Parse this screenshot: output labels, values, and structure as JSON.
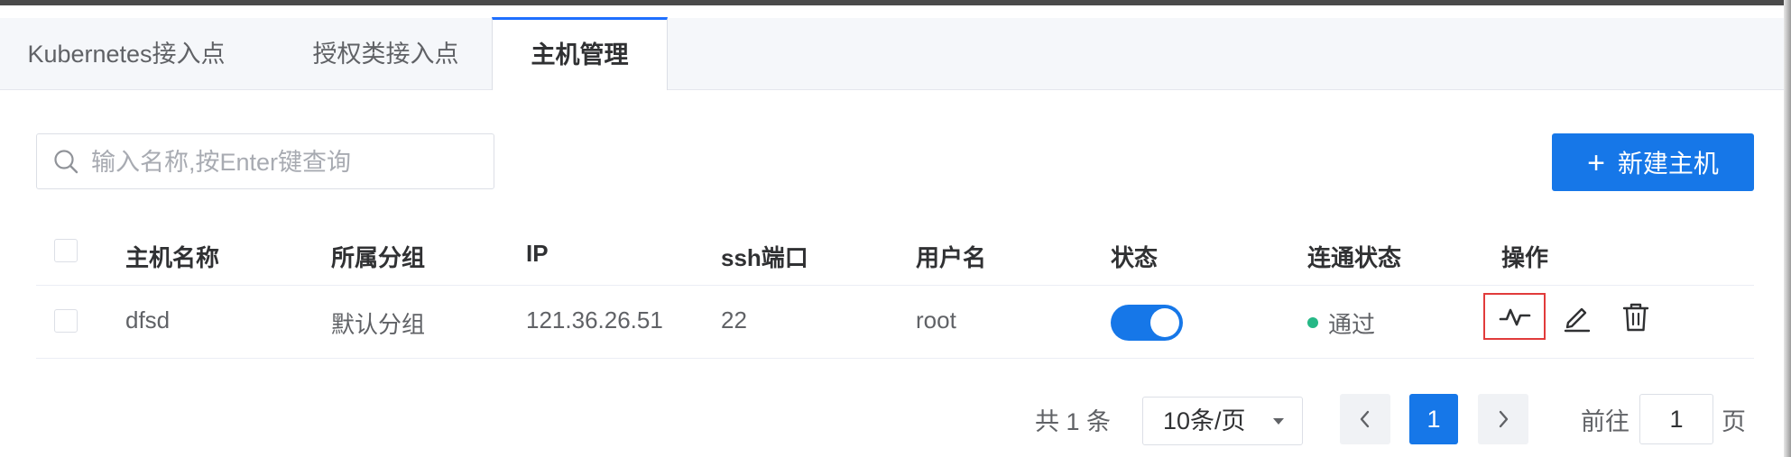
{
  "tabs": [
    {
      "label": "Kubernetes接入点",
      "active": false
    },
    {
      "label": "授权类接入点",
      "active": false
    },
    {
      "label": "主机管理",
      "active": true
    }
  ],
  "toolbar": {
    "search_placeholder": "输入名称,按Enter键查询",
    "search_value": "",
    "new_host_label": "新建主机",
    "new_host_icon": "plus-icon"
  },
  "table": {
    "columns": [
      "主机名称",
      "所属分组",
      "IP",
      "ssh端口",
      "用户名",
      "状态",
      "连通状态",
      "操作"
    ],
    "rows": [
      {
        "name": "dfsd",
        "group": "默认分组",
        "ip": "121.36.26.51",
        "port": "22",
        "user": "root",
        "status_enabled": true,
        "connectivity": "通过",
        "connectivity_color": "#26b886",
        "actions": [
          "activity-icon",
          "edit-icon",
          "trash-icon"
        ]
      }
    ]
  },
  "pagination": {
    "total_text": "共 1 条",
    "page_size": "10条/页",
    "current_page": "1",
    "goto_label": "前往",
    "goto_value": "1",
    "page_suffix": "页"
  },
  "colors": {
    "primary": "#1677e8",
    "highlight_border": "#e13b3b",
    "success": "#26b886"
  }
}
